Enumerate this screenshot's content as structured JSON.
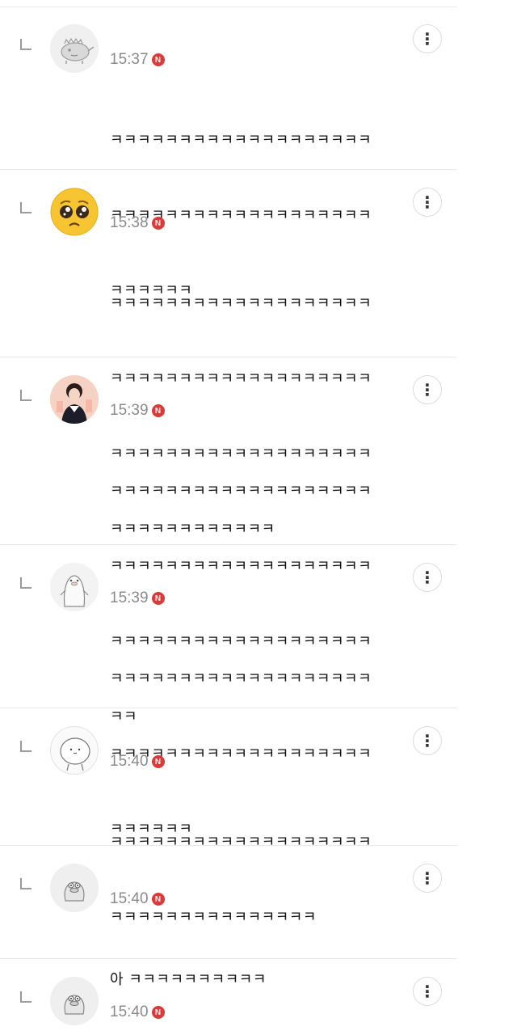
{
  "comments": [
    {
      "time": "15:37",
      "badge": "N",
      "avatar_icon": "sleeping-dino-icon",
      "lines": [
        "ㅋㅋㅋㅋㅋㅋㅋㅋㅋㅋㅋㅋㅋㅋㅋㅋㅋㅋㅋ",
        "ㅋㅋㅋㅋㅋㅋㅋㅋㅋㅋㅋㅋㅋㅋㅋㅋㅋㅋㅋ",
        "ㅋㅋㅋㅋㅋㅋ"
      ]
    },
    {
      "time": "15:38",
      "badge": "N",
      "avatar_icon": "pleading-face-icon",
      "lines": [
        "ㅋㅋㅋㅋㅋㅋㅋㅋㅋㅋㅋㅋㅋㅋㅋㅋㅋㅋㅋ",
        "ㅋㅋㅋㅋㅋㅋㅋㅋㅋㅋㅋㅋㅋㅋㅋㅋㅋㅋㅋ",
        "ㅋㅋㅋㅋㅋㅋㅋㅋㅋㅋㅋㅋㅋㅋㅋㅋㅋㅋㅋ",
        "ㅋㅋㅋㅋㅋㅋㅋㅋㅋㅋㅋㅋ"
      ]
    },
    {
      "time": "15:39",
      "badge": "N",
      "avatar_icon": "person-photo-icon",
      "lines": [
        "ㅋㅋㅋㅋㅋㅋㅋㅋㅋㅋㅋㅋㅋㅋㅋㅋㅋㅋㅋ",
        "ㅋㅋㅋㅋㅋㅋㅋㅋㅋㅋㅋㅋㅋㅋㅋㅋㅋㅋㅋ",
        "ㅋㅋㅋㅋㅋㅋㅋㅋㅋㅋㅋㅋㅋㅋㅋㅋㅋㅋㅋ",
        "ㅋㅋ"
      ]
    },
    {
      "time": "15:39",
      "badge": "N",
      "avatar_icon": "penguin-icon",
      "lines": [
        "ㅋㅋㅋㅋㅋㅋㅋㅋㅋㅋㅋㅋㅋㅋㅋㅋㅋㅋㅋ",
        "ㅋㅋㅋㅋㅋㅋㅋㅋㅋㅋㅋㅋㅋㅋㅋㅋㅋㅋㅋ",
        "ㅋㅋㅋㅋㅋㅋ"
      ]
    },
    {
      "time": "15:40",
      "badge": "N",
      "avatar_icon": "round-face-icon",
      "lines": [
        "ㅋㅋㅋㅋㅋㅋㅋㅋㅋㅋㅋㅋㅋㅋㅋㅋㅋㅋㅋ",
        "ㅋㅋㅋㅋㅋㅋㅋㅋㅋㅋㅋㅋㅋㅋㅋ"
      ]
    },
    {
      "time": "15:40",
      "badge": "N",
      "avatar_icon": "duck-icon",
      "lines": [
        "아 ㅋㅋㅋㅋㅋㅋㅋㅋㅋㅋ"
      ]
    },
    {
      "time": "15:40",
      "badge": "N",
      "avatar_icon": "duck-icon",
      "lines": []
    }
  ],
  "more_button_glyph": "⋮",
  "colors": {
    "badge": "#d93b3b",
    "time": "#8a8a8a",
    "divider": "#e8e8e8"
  }
}
